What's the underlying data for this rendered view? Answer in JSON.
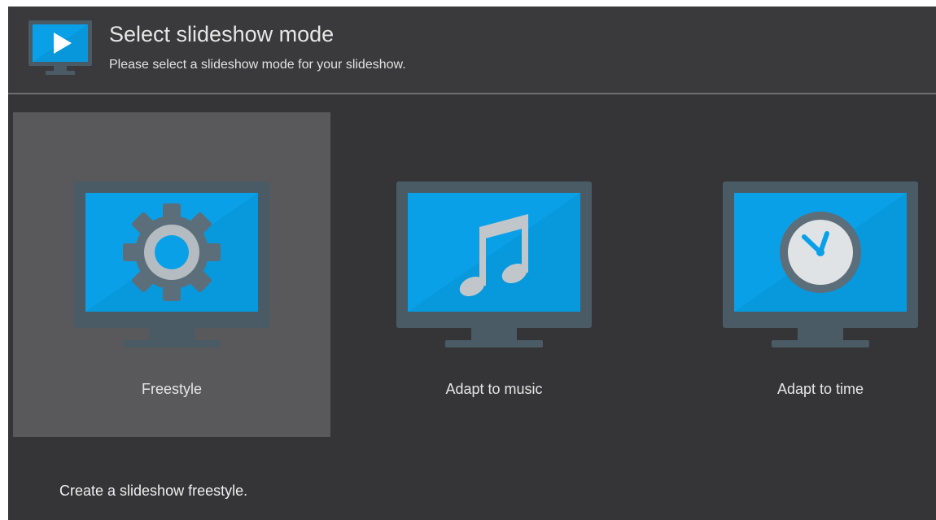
{
  "header": {
    "title": "Select slideshow mode",
    "subtitle": "Please select a slideshow mode for your slideshow.",
    "icon": "slideshow-play-icon"
  },
  "modes": [
    {
      "label": "Freestyle",
      "icon": "gear-icon",
      "selected": true
    },
    {
      "label": "Adapt to music",
      "icon": "music-note-icon",
      "selected": false
    },
    {
      "label": "Adapt to time",
      "icon": "clock-icon",
      "selected": false
    }
  ],
  "description": "Create a slideshow freestyle.",
  "colors": {
    "background": "#353537",
    "header_background": "#3a3a3c",
    "selected_tile": "#59595b",
    "monitor_frame": "#4a5b66",
    "screen_blue": "#0aa0e8",
    "text": "#e6e6e6"
  }
}
